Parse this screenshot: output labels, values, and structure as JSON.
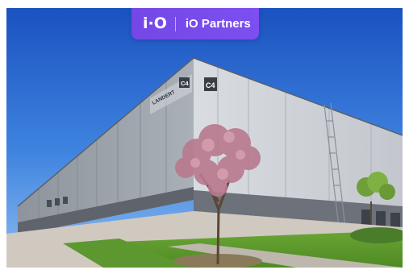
{
  "badge": {
    "logo": "i·O",
    "name": "iO Partners"
  },
  "building": {
    "brand_sign": "LANDERT",
    "unit_label": "C4"
  },
  "colors": {
    "badge": "#7447e6",
    "sky_top": "#1d5fcc",
    "sky_bottom": "#6fa6ea",
    "facade": "#c9ccd1",
    "facade_base": "#6e737c",
    "grass": "#5f9c2d",
    "blossom": "#b97a8e"
  }
}
